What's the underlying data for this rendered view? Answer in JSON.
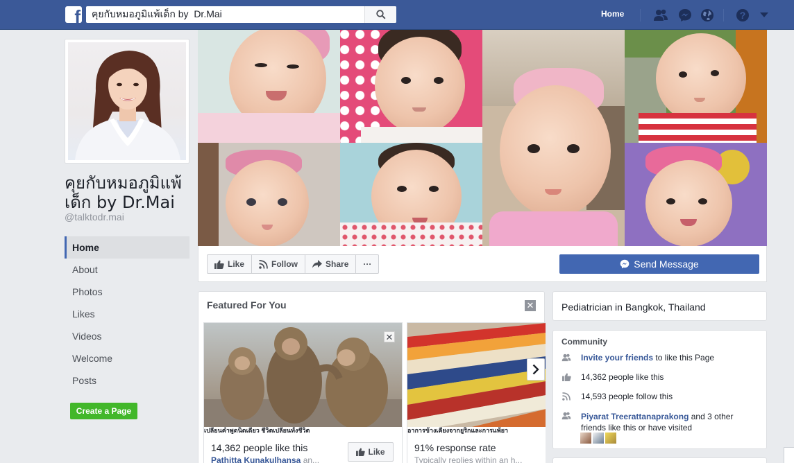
{
  "topbar": {
    "search_value": "คุยกับหมอภูมิแพ้เด็ก by  Dr.Mai",
    "home_label": "Home"
  },
  "colors": {
    "brand_blue": "#3b5998",
    "button_blue": "#4267b2",
    "create_green": "#42b72a",
    "link_blue": "#385898"
  },
  "page": {
    "name": "คุยกับหมอภูมิแพ้เด็ก by Dr.Mai",
    "handle": "@talktodr.mai"
  },
  "left_nav": [
    {
      "label": "Home"
    },
    {
      "label": "About"
    },
    {
      "label": "Photos"
    },
    {
      "label": "Likes"
    },
    {
      "label": "Videos"
    },
    {
      "label": "Welcome"
    },
    {
      "label": "Posts"
    }
  ],
  "create_page_label": "Create a Page",
  "actions": {
    "like": "Like",
    "follow": "Follow",
    "share": "Share",
    "more": "···",
    "send_message": "Send Message"
  },
  "featured": {
    "title": "Featured For You",
    "cards": [
      {
        "caption": "เปลี่ยนคำพูดนิดเดียว ชีวิตเปลี่ยนทั้งชีวิต",
        "line1": "14,362 people like this",
        "line2_name": "Pathitta Kunakulhansa",
        "line2_rest": " an...",
        "like_label": "Like"
      },
      {
        "caption": "อาการข้างเคียงจากยูริกและการแพ้ยา",
        "line1": "91% response rate",
        "line2_rest": "Typically replies within an h..."
      }
    ]
  },
  "category": "Pediatrician in Bangkok, Thailand",
  "community": {
    "title": "Community",
    "invite_link": "Invite your friends",
    "invite_rest": " to like this Page",
    "likes": "14,362 people like this",
    "follows": "14,593 people follow this",
    "friend_name": "Piyarat Treerattanaprakong",
    "friend_rest_1": " and 3 other",
    "friend_rest_2": "friends like this or have visited"
  },
  "icons": [
    "facebook-logo-icon",
    "search-icon",
    "friends-icon",
    "messenger-icon",
    "globe-icon",
    "help-icon",
    "caret-down-icon",
    "thumbs-up-icon",
    "rss-icon",
    "share-arrow-icon",
    "messenger-icon",
    "close-icon",
    "chevron-right-icon",
    "people-icon"
  ]
}
